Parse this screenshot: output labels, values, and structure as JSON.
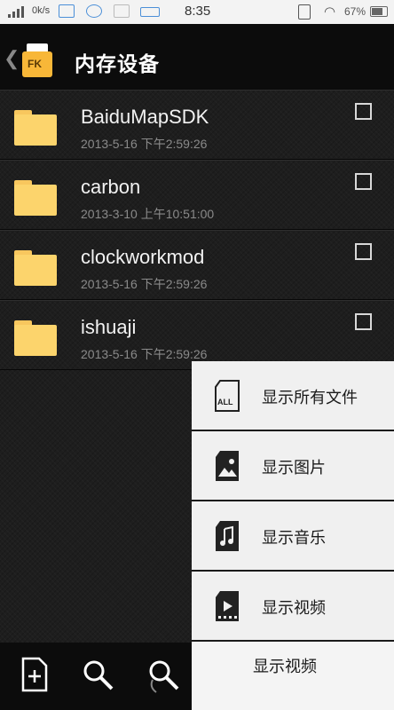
{
  "status_bar": {
    "net_speed": "0k/s",
    "time": "8:35",
    "battery": "67%"
  },
  "header": {
    "title": "内存设备",
    "app_icon_text": "FK",
    "back_icon": "chevron-left-icon"
  },
  "files": [
    {
      "name": "BaiduMapSDK",
      "date": "2013-5-16 下午2:59:26"
    },
    {
      "name": "carbon",
      "date": "2013-3-10 上午10:51:00"
    },
    {
      "name": "clockworkmod",
      "date": "2013-5-16 下午2:59:26"
    },
    {
      "name": "ishuaji",
      "date": "2013-5-16 下午2:59:26"
    }
  ],
  "menu": {
    "items": [
      {
        "label": "显示所有文件",
        "icon": "all-files-icon",
        "icon_text": "ALL"
      },
      {
        "label": "显示图片",
        "icon": "image-file-icon"
      },
      {
        "label": "显示音乐",
        "icon": "music-file-icon"
      },
      {
        "label": "显示视频",
        "icon": "video-file-icon"
      }
    ],
    "ghost_label": "显示视频"
  },
  "bottom_bar": {
    "buttons": [
      "new-file-icon",
      "search-icon",
      "search-alt-icon"
    ]
  },
  "colors": {
    "folder": "#fcd46c",
    "menu_bg": "#f0f0f0",
    "app_icon": "#f8b738"
  }
}
